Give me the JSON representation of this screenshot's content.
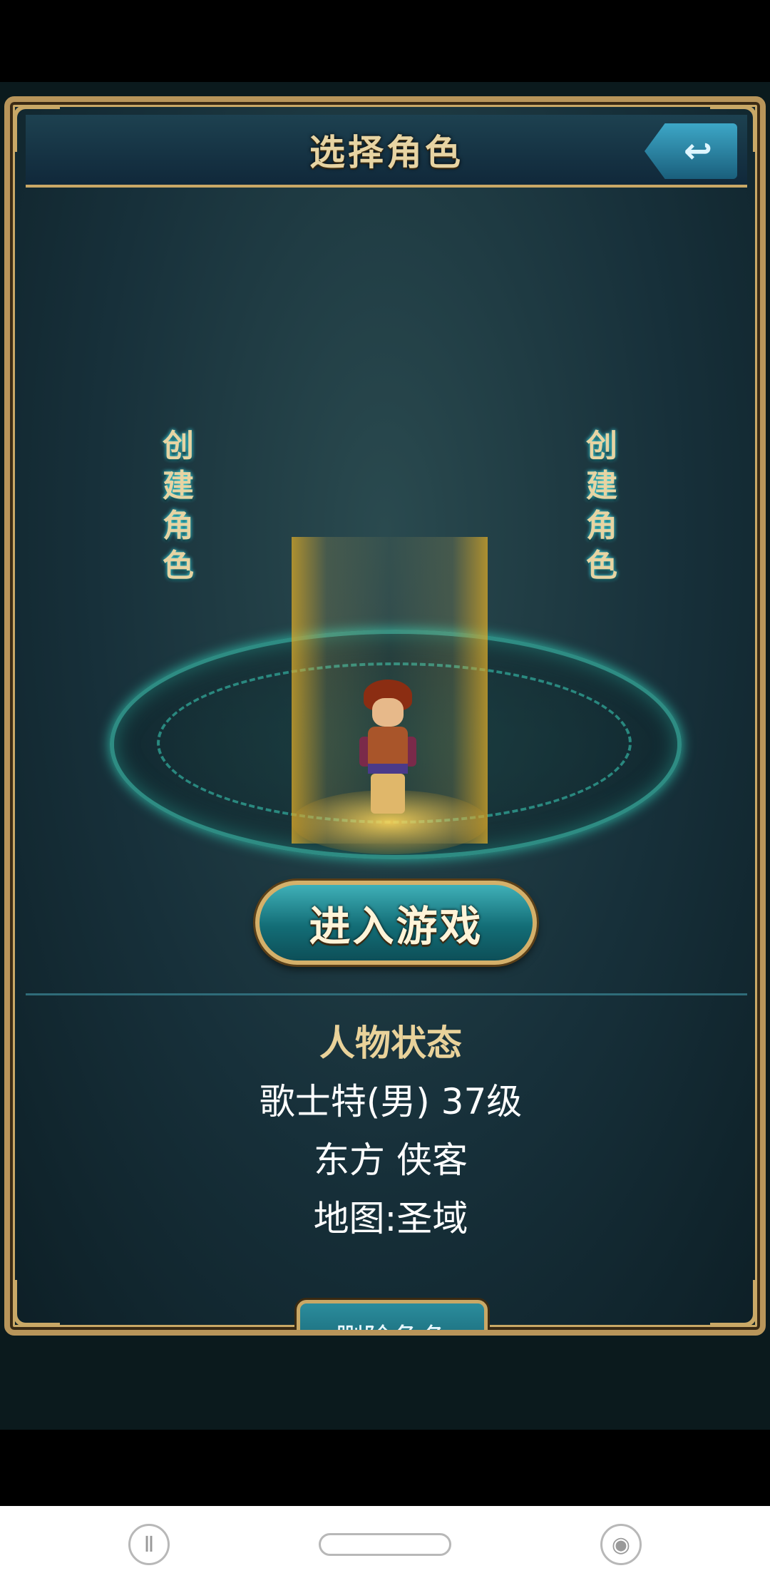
{
  "header": {
    "title": "选择角色",
    "back_icon": "back-arrow-icon"
  },
  "slots": {
    "left_create_label": [
      "创",
      "建",
      "角",
      "色"
    ],
    "right_create_label": [
      "创",
      "建",
      "角",
      "色"
    ]
  },
  "actions": {
    "enter_game_label": "进入游戏",
    "delete_character_label": "删除角色"
  },
  "status": {
    "title": "人物状态",
    "name_level": "歌士特(男) 37级",
    "class_info": "东方 侠客",
    "map": "地图:圣域"
  },
  "colors": {
    "gold_frame": "#c9a866",
    "title_text": "#e7d4a3",
    "button_teal": "#136d76"
  },
  "nav_bar": {
    "left_icon": "app-switch-icon",
    "center_icon": "home-pill",
    "right_icon": "assistant-icon"
  }
}
